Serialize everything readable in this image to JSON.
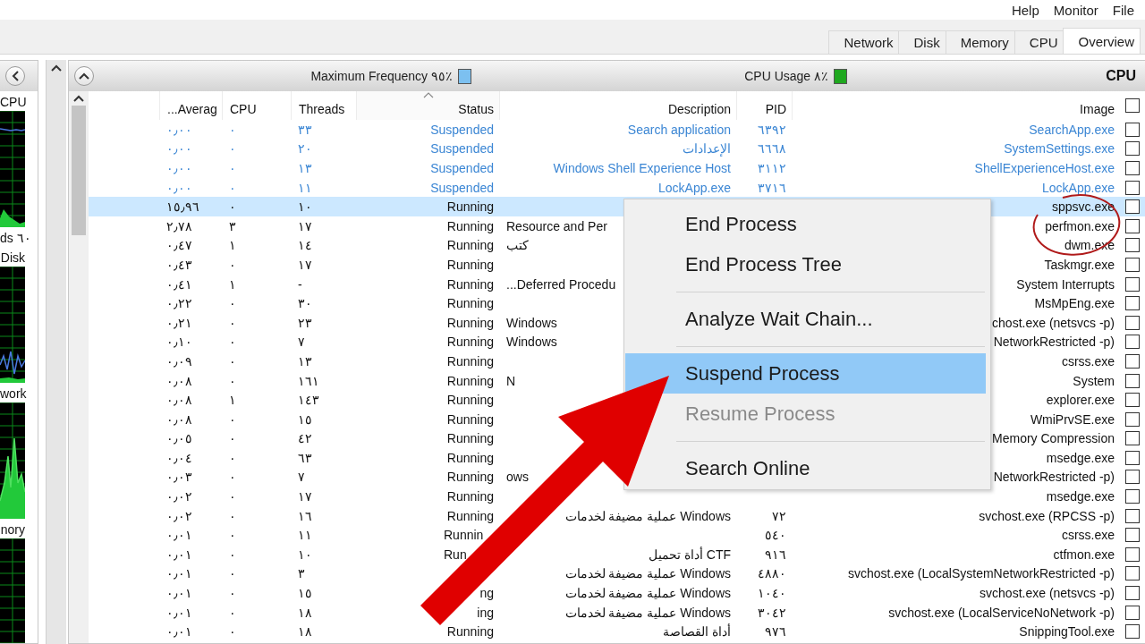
{
  "menu_bar": [
    "File",
    "Monitor",
    "Help"
  ],
  "tabs": [
    {
      "label": "Overview",
      "selected": true
    },
    {
      "label": "CPU",
      "selected": false
    },
    {
      "label": "Memory",
      "selected": false
    },
    {
      "label": "Disk",
      "selected": false
    },
    {
      "label": "Network",
      "selected": false
    }
  ],
  "side_panel": {
    "items": [
      {
        "kind": "label",
        "text": "CPU"
      },
      {
        "kind": "graph"
      },
      {
        "kind": "label",
        "text": "ds ٦٠"
      },
      {
        "kind": "label",
        "text": "Disk"
      },
      {
        "kind": "graph"
      },
      {
        "kind": "label",
        "text": "work"
      },
      {
        "kind": "graph"
      },
      {
        "kind": "label",
        "text": "nory"
      },
      {
        "kind": "graph"
      }
    ]
  },
  "cpu_panel": {
    "title": "CPU",
    "cpu_usage": "CPU Usage ٨٪",
    "max_frequency": "Maximum Frequency ٩٥٪",
    "columns": [
      {
        "label": "Image",
        "sorted": false
      },
      {
        "label": "PID",
        "sorted": false
      },
      {
        "label": "Description",
        "sorted": false
      },
      {
        "label": "Status",
        "sorted": true
      },
      {
        "label": "Threads",
        "sorted": false
      },
      {
        "label": "CPU",
        "sorted": false
      },
      {
        "label": "...Averag",
        "sorted": false
      }
    ],
    "header_checked": false,
    "rows": [
      {
        "average": "٠٫٠٠",
        "cpu": "٠",
        "threads": "٣٣",
        "status": "Suspended",
        "description": "Search application",
        "pid": "٦٣٩٢",
        "image": "SearchApp.exe",
        "checked": false,
        "selected": false,
        "suspended": true
      },
      {
        "average": "٠٫٠٠",
        "cpu": "٠",
        "threads": "٢٠",
        "status": "Suspended",
        "description": "الإعدادات",
        "pid": "٦٦٦٨",
        "image": "SystemSettings.exe",
        "checked": false,
        "selected": false,
        "suspended": true
      },
      {
        "average": "٠٫٠٠",
        "cpu": "٠",
        "threads": "١٣",
        "status": "Suspended",
        "description": "Windows Shell Experience Host",
        "pid": "٣١١٢",
        "image": "ShellExperienceHost.exe",
        "checked": false,
        "selected": false,
        "suspended": true
      },
      {
        "average": "٠٫٠٠",
        "cpu": "٠",
        "threads": "١١",
        "status": "Suspended",
        "description": "LockApp.exe",
        "pid": "٣٧١٦",
        "image": "LockApp.exe",
        "checked": false,
        "selected": false,
        "suspended": true
      },
      {
        "average": "١٥٫٩٦",
        "cpu": "٠",
        "threads": "١٠",
        "status": "Running",
        "image": "sppsvc.exe",
        "checked": false,
        "selected": true,
        "suspended": false
      },
      {
        "average": "٢٫٧٨",
        "cpu": "٣",
        "threads": "١٧",
        "status": "Running",
        "description": "Resource and Per",
        "desc_cut": true,
        "image": "perfmon.exe",
        "checked": false,
        "selected": false,
        "suspended": false
      },
      {
        "average": "٠٫٤٧",
        "cpu": "١",
        "threads": "١٤",
        "status": "Running",
        "description": "كتب",
        "desc_cut": true,
        "image": "dwm.exe",
        "checked": false,
        "selected": false,
        "suspended": false
      },
      {
        "average": "٠٫٤٣",
        "cpu": "٠",
        "threads": "١٧",
        "status": "Running",
        "image": "Taskmgr.exe",
        "checked": false,
        "selected": false,
        "suspended": false
      },
      {
        "average": "٠٫٤١",
        "cpu": "١",
        "threads": "-",
        "status": "Running",
        "description": "...Deferred Procedu",
        "desc_cut": true,
        "image": "System Interrupts",
        "checked": false,
        "selected": false,
        "suspended": false
      },
      {
        "average": "٠٫٢٢",
        "cpu": "٠",
        "threads": "٣٠",
        "status": "Running",
        "image": "MsMpEng.exe",
        "checked": false,
        "selected": false,
        "suspended": false
      },
      {
        "average": "٠٫٢١",
        "cpu": "٠",
        "threads": "٢٣",
        "status": "Running",
        "description": "Windows",
        "desc_cut": true,
        "image": "chost.exe (netsvcs -p)",
        "checked": false,
        "selected": false,
        "suspended": false
      },
      {
        "average": "٠٫١٠",
        "cpu": "٠",
        "threads": "٧",
        "status": "Running",
        "description": "Windows",
        "desc_cut": true,
        "image": "NetworkRestricted -p)",
        "checked": false,
        "selected": false,
        "suspended": false
      },
      {
        "average": "٠٫٠٩",
        "cpu": "٠",
        "threads": "١٣",
        "status": "Running",
        "image": "csrss.exe",
        "checked": false,
        "selected": false,
        "suspended": false
      },
      {
        "average": "٠٫٠٨",
        "cpu": "٠",
        "threads": "١٦١",
        "status": "Running",
        "description": "N",
        "desc_cut": true,
        "image": "System",
        "checked": false,
        "selected": false,
        "suspended": false
      },
      {
        "average": "٠٫٠٨",
        "cpu": "١",
        "threads": "١٤٣",
        "status": "Running",
        "image": "explorer.exe",
        "checked": false,
        "selected": false,
        "suspended": false
      },
      {
        "average": "٠٫٠٨",
        "cpu": "٠",
        "threads": "١٥",
        "status": "Running",
        "image": "WmiPrvSE.exe",
        "checked": false,
        "selected": false,
        "suspended": false
      },
      {
        "average": "٠٫٠٥",
        "cpu": "٠",
        "threads": "٤٢",
        "status": "Running",
        "image": "Memory Compression",
        "checked": false,
        "selected": false,
        "suspended": false
      },
      {
        "average": "٠٫٠٤",
        "cpu": "٠",
        "threads": "٦٣",
        "status": "Running",
        "image": "msedge.exe",
        "checked": false,
        "selected": false,
        "suspended": false
      },
      {
        "average": "٠٫٠٣",
        "cpu": "٠",
        "threads": "٧",
        "status": "Running",
        "description": "ows",
        "desc_cut": true,
        "image": "NetworkRestricted -p)",
        "checked": false,
        "selected": false,
        "suspended": false
      },
      {
        "average": "٠٫٠٢",
        "cpu": "٠",
        "threads": "١٧",
        "status": "Running",
        "image": "msedge.exe",
        "checked": false,
        "selected": false,
        "suspended": false
      },
      {
        "average": "٠٫٠٢",
        "cpu": "٠",
        "threads": "١٦",
        "status": "Running",
        "description": "عملية مضيفة لخدمات Windows",
        "pid": "٧٢",
        "image": "svchost.exe (RPCSS -p)",
        "checked": false,
        "selected": false,
        "suspended": false
      },
      {
        "average": "٠٫٠١",
        "cpu": "٠",
        "threads": "١١",
        "status": "Runnin",
        "status_left": true,
        "pid": "٥٤٠",
        "image": "csrss.exe",
        "checked": false,
        "selected": false,
        "suspended": false
      },
      {
        "average": "٠٫٠١",
        "cpu": "٠",
        "threads": "١٠",
        "status": "Run",
        "status_left": true,
        "description": "أداة تحميل CTF",
        "pid": "٩١٦",
        "image": "ctfmon.exe",
        "checked": false,
        "selected": false,
        "suspended": false
      },
      {
        "average": "٠٫٠١",
        "cpu": "٠",
        "threads": "٣",
        "description": "عملية مضيفة لخدمات Windows",
        "pid": "٤٨٨٠",
        "image": "svchost.exe (LocalSystemNetworkRestricted -p)",
        "checked": false,
        "selected": false,
        "suspended": false
      },
      {
        "average": "٠٫٠١",
        "cpu": "٠",
        "threads": "١٥",
        "status": "ng",
        "description": "عملية مضيفة لخدمات Windows",
        "pid": "١٠٤٠",
        "image": "svchost.exe (netsvcs -p)",
        "checked": false,
        "selected": false,
        "suspended": false
      },
      {
        "average": "٠٫٠١",
        "cpu": "٠",
        "threads": "١٨",
        "status": "ing",
        "description": "عملية مضيفة لخدمات Windows",
        "pid": "٣٠٤٢",
        "image": "svchost.exe (LocalServiceNoNetwork -p)",
        "checked": false,
        "selected": false,
        "suspended": false
      },
      {
        "average": "٠٫٠١",
        "cpu": "٠",
        "threads": "١٨",
        "status": "Running",
        "description": "أداة القصاصة",
        "pid": "٩٧٦",
        "image": "SnippingTool.exe",
        "checked": false,
        "selected": false,
        "suspended": false
      }
    ]
  },
  "context_menu": {
    "items": [
      {
        "kind": "item",
        "label": "End Process",
        "selected": false,
        "disabled": false
      },
      {
        "kind": "item",
        "label": "End Process Tree",
        "selected": false,
        "disabled": false
      },
      {
        "kind": "separator"
      },
      {
        "kind": "item",
        "label": "Analyze Wait Chain...",
        "selected": false,
        "disabled": false
      },
      {
        "kind": "separator"
      },
      {
        "kind": "item",
        "label": "Suspend Process",
        "selected": true,
        "disabled": false
      },
      {
        "kind": "item",
        "label": "Resume Process",
        "selected": false,
        "disabled": true
      },
      {
        "kind": "separator"
      },
      {
        "kind": "item",
        "label": "Search Online",
        "selected": false,
        "disabled": false
      }
    ]
  },
  "annotations": {
    "circle": true,
    "arrow": true
  }
}
